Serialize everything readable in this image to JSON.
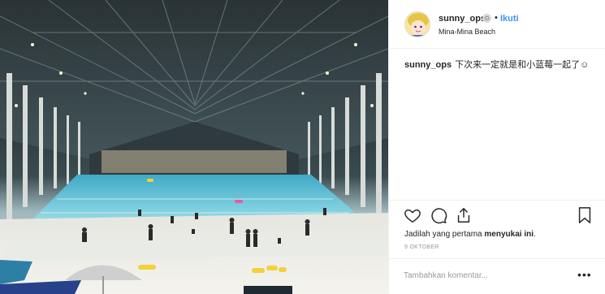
{
  "post": {
    "username": "sunny_ops",
    "verified_glyph": "⊙",
    "separator": "•",
    "follow_label": "Ikuti",
    "location": "Mina-Mina Beach",
    "caption_user": "sunny_ops",
    "caption_text": "下次来一定就是和小蓝莓一起了☺",
    "likes_prefix": "Jadilah yang pertama ",
    "likes_bold": "menyukai ini",
    "likes_suffix": ".",
    "date": "9 OKTOBER",
    "comment_placeholder": "Tambahkan komentar...",
    "more_glyph": "•••"
  },
  "icons": {
    "like": "heart-icon",
    "comment": "comment-icon",
    "share": "share-icon",
    "save": "bookmark-icon"
  },
  "colors": {
    "follow": "#3897f0",
    "text": "#262626",
    "muted": "#999999",
    "border": "#efefef"
  }
}
